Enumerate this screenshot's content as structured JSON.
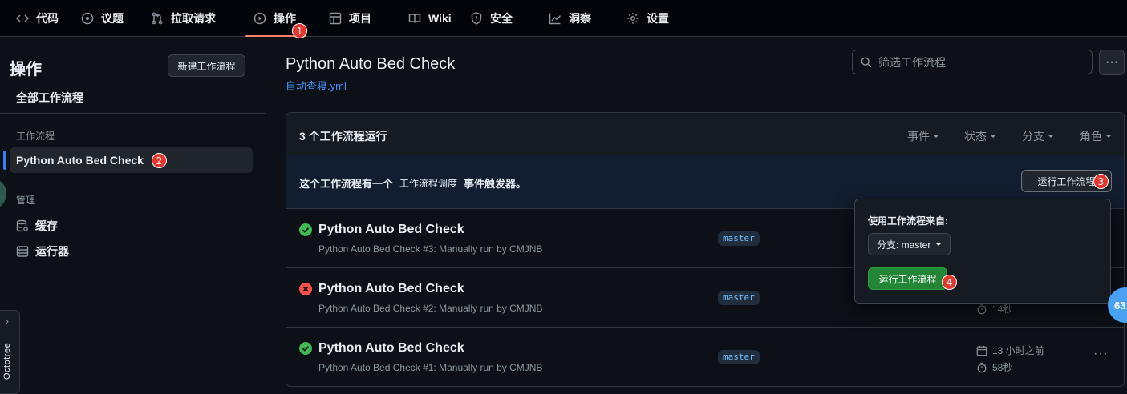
{
  "nav": {
    "items": [
      {
        "label": "代码",
        "icon": "code-icon"
      },
      {
        "label": "议题",
        "icon": "issue-icon"
      },
      {
        "label": "拉取请求",
        "icon": "pull-request-icon"
      },
      {
        "label": "操作",
        "icon": "play-icon",
        "active": true
      },
      {
        "label": "项目",
        "icon": "table-icon"
      },
      {
        "label": "Wiki",
        "icon": "book-icon"
      },
      {
        "label": "安全",
        "icon": "shield-icon"
      },
      {
        "label": "洞察",
        "icon": "graph-icon"
      },
      {
        "label": "设置",
        "icon": "gear-icon"
      }
    ]
  },
  "annotations": [
    "1",
    "2",
    "3",
    "4"
  ],
  "sidebar": {
    "title": "操作",
    "new_workflow_button": "新建工作流程",
    "all_workflows": "全部工作流程",
    "workflows_section": "工作流程",
    "selected_workflow": "Python Auto Bed Check",
    "manage_section": "管理",
    "cache": "缓存",
    "runners": "运行器"
  },
  "octotree": {
    "label": "Octotree"
  },
  "main": {
    "title": "Python Auto Bed Check",
    "file": "自动查寝.yml",
    "search_placeholder": "筛选工作流程",
    "run_count": "3 个工作流程运行",
    "filters": [
      "事件",
      "状态",
      "分支",
      "角色"
    ],
    "dispatch_text_1": "这个工作流程有一个",
    "dispatch_code": "工作流程调度",
    "dispatch_text_2": "事件触发器。",
    "run_workflow_button": "运行工作流程"
  },
  "runs": [
    {
      "title": "Python Auto Bed Check",
      "meta": "Python Auto Bed Check #3: Manually run by CMJNB",
      "branch": "master",
      "status": "success"
    },
    {
      "title": "Python Auto Bed Check",
      "meta": "Python Auto Bed Check #2: Manually run by CMJNB",
      "branch": "master",
      "status": "failure",
      "duration": "14秒"
    },
    {
      "title": "Python Auto Bed Check",
      "meta": "Python Auto Bed Check #1: Manually run by CMJNB",
      "branch": "master",
      "status": "success",
      "time_ago": "13 小时之前",
      "duration": "58秒"
    }
  ],
  "popover": {
    "title": "使用工作流程来自:",
    "branch_label": "分支: master",
    "run_button": "运行工作流程"
  },
  "floating_badge": "63",
  "colors": {
    "accent": "#2f81f7",
    "success": "#3fb950",
    "failure": "#f85149",
    "annotation": "#e5362f",
    "primary_button": "#238636"
  }
}
